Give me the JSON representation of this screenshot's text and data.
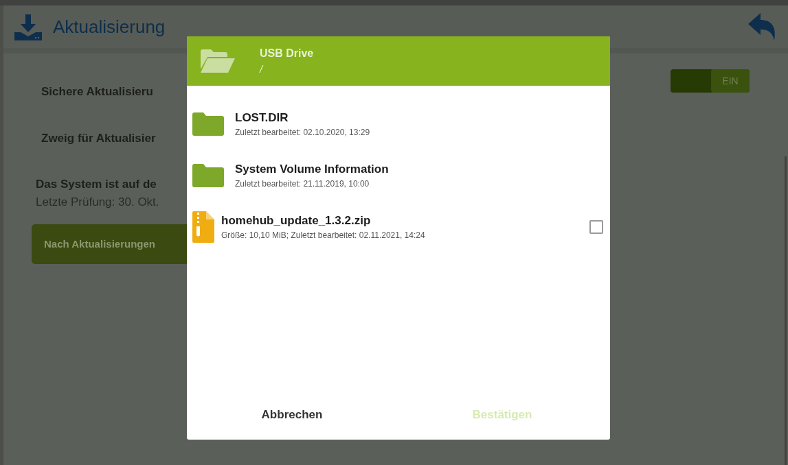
{
  "header": {
    "title": "Aktualisierung"
  },
  "settings": [
    {
      "kind": "toggle",
      "label": "Sichere Aktualisieru",
      "on": true,
      "toggle_label": "EIN"
    },
    {
      "kind": "plain",
      "label": "Zweig für Aktualisier"
    }
  ],
  "status": {
    "title": "Das System ist auf de",
    "last_check": "Letzte Prüfung: 30. Okt."
  },
  "check_button": {
    "label": "Nach Aktualisierungen"
  },
  "dialog": {
    "title": "USB Drive",
    "path": "/",
    "items": [
      {
        "kind": "folder",
        "name": "LOST.DIR",
        "details": "Zuletzt bearbeitet: 02.10.2020, 13:29"
      },
      {
        "kind": "folder",
        "name": "System Volume Information",
        "details": "Zuletzt bearbeitet: 21.11.2019, 10:00"
      },
      {
        "kind": "zip",
        "name": "homehub_update_1.3.2.zip",
        "details": "Größe: 10,10 MiB; Zuletzt bearbeitet: 02.11.2021, 14:24",
        "checked": false
      }
    ],
    "cancel": "Abbrechen",
    "confirm": {
      "label": "Bestätigen",
      "disabled": true
    }
  }
}
